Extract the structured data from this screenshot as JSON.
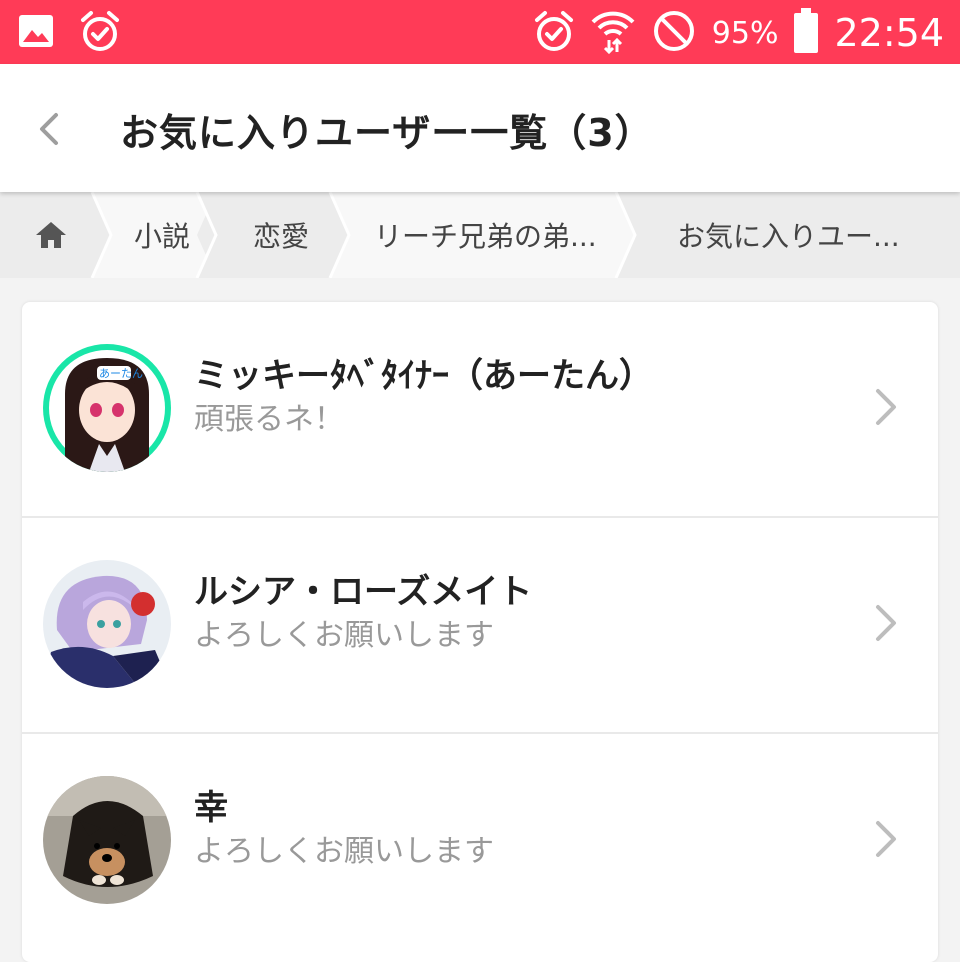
{
  "status_bar": {
    "battery": "95%",
    "time": "22:54"
  },
  "header": {
    "title": "お気に入りユーザー一覧（3）"
  },
  "breadcrumb": {
    "items": [
      {
        "label": "小説"
      },
      {
        "label": "恋愛"
      },
      {
        "label": "リーチ兄弟の弟..."
      },
      {
        "label": "お気に入りユー..."
      }
    ]
  },
  "users": [
    {
      "name": "ミッキーﾀﾍﾞﾀｲﾅｰ（あーたん）",
      "comment": "頑張るネ！"
    },
    {
      "name": "ルシア・ローズメイト",
      "comment": "よろしくお願いします"
    },
    {
      "name": "幸",
      "comment": "よろしくお願いします"
    }
  ],
  "colors": {
    "status_bar": "#ff3b57",
    "title_text": "#222222",
    "sub_text": "#999999",
    "chevron": "#bdbdbd"
  }
}
